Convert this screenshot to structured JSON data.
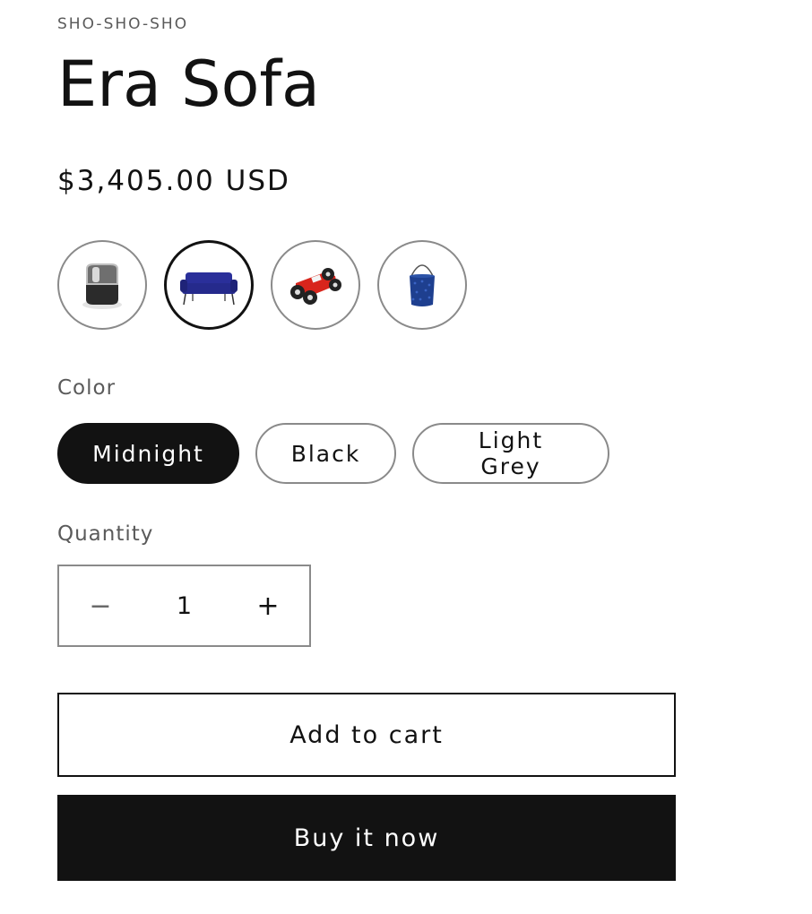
{
  "product": {
    "vendor": "SHO-SHO-SHO",
    "title": "Era Sofa",
    "price": "$3,405.00 USD"
  },
  "thumbnails": [
    {
      "icon": "speaker-icon",
      "selected": false
    },
    {
      "icon": "sofa-icon",
      "selected": true
    },
    {
      "icon": "toy-race-car-icon",
      "selected": false
    },
    {
      "icon": "basket-icon",
      "selected": false
    }
  ],
  "color": {
    "label": "Color",
    "options": [
      "Midnight",
      "Black",
      "Light Grey"
    ],
    "selected": "Midnight"
  },
  "quantity": {
    "label": "Quantity",
    "value": "1",
    "decrement": "−",
    "increment": "+"
  },
  "actions": {
    "add_to_cart": "Add to cart",
    "buy_now": "Buy it now"
  },
  "colors": {
    "text": "#121212",
    "muted": "#5a5a5a",
    "border": "#8a8a8a",
    "primary_button": "#121212"
  }
}
